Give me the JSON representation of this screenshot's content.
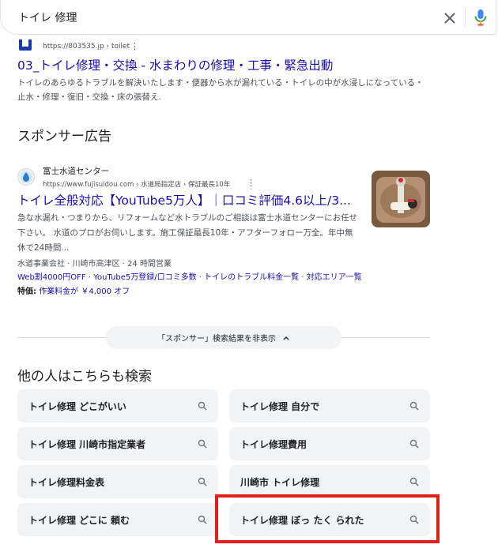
{
  "search": {
    "query": "トイレ 修理"
  },
  "result1": {
    "url": "https://803535.jp › toilet",
    "title": "03_トイレ修理・交換 - 水まわりの修理・工事・緊急出動",
    "snippet": "トイレのあらゆるトラブルを解決いたします・便器から水が漏れている・トイレの中が水浸しになっている・止水・修理・復旧・交換・床の張替え."
  },
  "sponsor": {
    "heading": "スポンサー広告",
    "ad": {
      "site_name": "富士水道センター",
      "url": "https://www.fujisuidou.com › 水道局指定店 › 保証最長10年",
      "title": "トイレ全般対応【YouTube5万人】｜口コミ評価4.6以上/3...",
      "snippet": "急な水漏れ・つまりから、リフォームなど水トラブルのご相談は富士水道センターにお任せ下さい。 水道のプロがお伺いします。施工保証最長10年・アフターフォロー万全。年中無休で24時間...",
      "address": "水道事業会社 · 川崎市高津区 · 24 時間営業",
      "sitelinks": [
        "Web割4000円OFF",
        "YouTube5万登録/口コミ多数",
        "トイレのトラブル料金一覧",
        "対応エリア一覧"
      ],
      "feature_label": "特価:",
      "feature_value": "作業料金が ￥4,000 オフ"
    },
    "hide_label": "「スポンサー」検索結果を非表示"
  },
  "related": {
    "heading": "他の人はこちらも検索",
    "items": [
      "トイレ修理 どこがいい",
      "トイレ修理 自分で",
      "トイレ修理 川崎市指定業者",
      "トイレ修理費用",
      "トイレ修理料金表",
      "川崎市 トイレ修理",
      "トイレ修理 どこに 頼む",
      "トイレ修理 ぼっ たく られた"
    ]
  },
  "colors": {
    "link": "#1a0dab",
    "highlight": "#e0201b",
    "chip_bg": "#f1f3f4"
  }
}
